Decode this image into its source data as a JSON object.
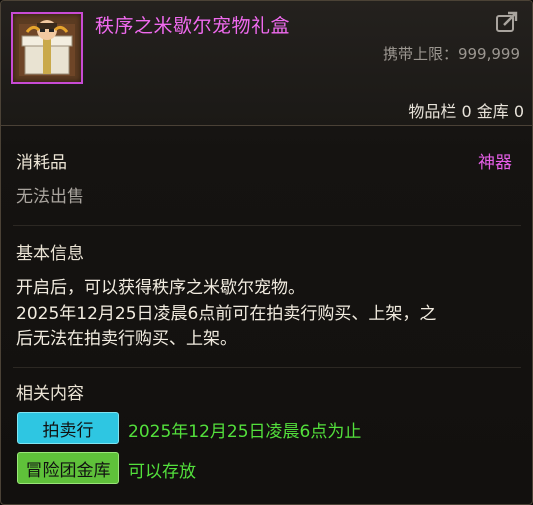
{
  "item": {
    "name": "秩序之米歇尔宠物礼盒",
    "carry_limit": "携带上限：999,999",
    "storage": "物品栏 0 金库 0"
  },
  "category": {
    "label": "消耗品",
    "grade": "神器",
    "trade": "无法出售"
  },
  "basic_info": {
    "title": "基本信息",
    "lines": [
      "开启后，可以获得秩序之米歇尔宠物。",
      "2025年12月25日凌晨6点前可在拍卖行购买、上架，之",
      "后无法在拍卖行购买、上架。"
    ]
  },
  "related": {
    "title": "相关内容",
    "items": [
      {
        "tag": "拍卖行",
        "note": "2025年12月25日凌晨6点为止",
        "color": "#2ec6e2"
      },
      {
        "tag": "冒险团金库",
        "note": "可以存放",
        "color": "#5fc13a"
      }
    ]
  },
  "colors": {
    "name": "#f06aef",
    "grade": "#e45ee6",
    "note": "#53e03c"
  },
  "icons": {
    "item": "gift-box-icon",
    "share": "share-icon"
  }
}
